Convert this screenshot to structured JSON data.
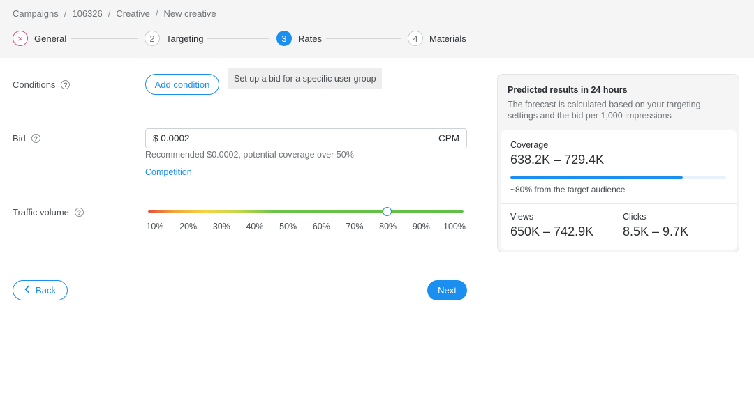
{
  "breadcrumb": [
    "Campaigns",
    "106326",
    "Creative",
    "New creative"
  ],
  "steps": [
    {
      "marker": "×",
      "label": "General",
      "state": "error"
    },
    {
      "marker": "2",
      "label": "Targeting",
      "state": "todo"
    },
    {
      "marker": "3",
      "label": "Rates",
      "state": "active"
    },
    {
      "marker": "4",
      "label": "Materials",
      "state": "todo"
    }
  ],
  "conditions": {
    "label": "Conditions",
    "add_button": "Add condition",
    "tooltip": "Set up a bid for a specific user group"
  },
  "bid": {
    "label": "Bid",
    "value": "$ 0.0002",
    "unit": "CPM",
    "hint": "Recommended $0.0002, potential coverage over 50%",
    "competition_link": "Competition"
  },
  "traffic": {
    "label": "Traffic volume",
    "ticks": [
      "10%",
      "20%",
      "30%",
      "40%",
      "50%",
      "60%",
      "70%",
      "80%",
      "90%",
      "100%"
    ],
    "selected_percent": 80
  },
  "nav": {
    "back": "Back",
    "next": "Next"
  },
  "forecast": {
    "title": "Predicted results in 24 hours",
    "description": "The forecast is calculated based on your targeting settings and the bid per 1,000 impressions",
    "coverage_label": "Coverage",
    "coverage_value": "638.2K – 729.4K",
    "coverage_fill_percent": 80,
    "coverage_note": "~80% from the target audience",
    "views_label": "Views",
    "views_value": "650K – 742.9K",
    "clicks_label": "Clicks",
    "clicks_value": "8.5K – 9.7K"
  },
  "colors": {
    "accent": "#1a8ff0",
    "error": "#e0447c"
  }
}
